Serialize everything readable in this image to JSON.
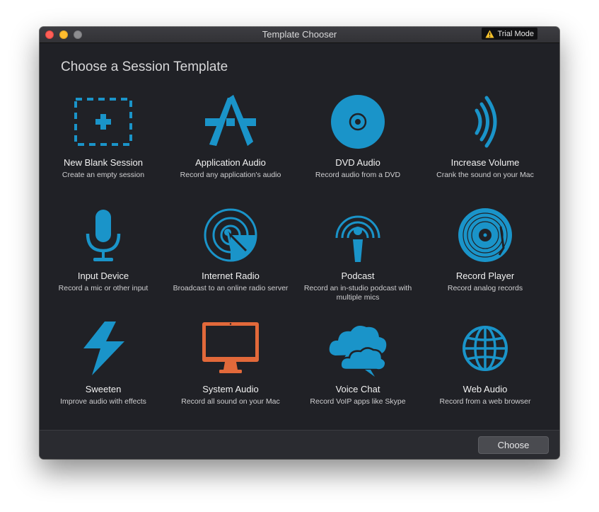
{
  "window": {
    "title": "Template Chooser",
    "trial_badge": "Trial Mode"
  },
  "heading": "Choose a Session Template",
  "colors": {
    "accent": "#1a94c9",
    "system_audio": "#e2693a",
    "warning": "#f5c12b"
  },
  "templates": [
    {
      "name": "New Blank Session",
      "desc": "Create an empty session",
      "icon": "plus-box-icon"
    },
    {
      "name": "Application Audio",
      "desc": "Record any application's audio",
      "icon": "app-store-icon"
    },
    {
      "name": "DVD Audio",
      "desc": "Record audio from a DVD",
      "icon": "disc-icon"
    },
    {
      "name": "Increase Volume",
      "desc": "Crank the sound on your Mac",
      "icon": "volume-waves-icon"
    },
    {
      "name": "Input Device",
      "desc": "Record a mic or other input",
      "icon": "microphone-icon"
    },
    {
      "name": "Internet Radio",
      "desc": "Broadcast to an online radio server",
      "icon": "radio-dish-icon"
    },
    {
      "name": "Podcast",
      "desc": "Record an in-studio podcast with multiple mics",
      "icon": "podcast-icon"
    },
    {
      "name": "Record Player",
      "desc": "Record analog records",
      "icon": "vinyl-record-icon"
    },
    {
      "name": "Sweeten",
      "desc": "Improve audio with effects",
      "icon": "lightning-icon"
    },
    {
      "name": "System Audio",
      "desc": "Record all sound on your Mac",
      "icon": "imac-icon"
    },
    {
      "name": "Voice Chat",
      "desc": "Record VoIP apps like Skype",
      "icon": "chat-clouds-icon"
    },
    {
      "name": "Web Audio",
      "desc": "Record from a web browser",
      "icon": "globe-icon"
    }
  ],
  "footer": {
    "choose_label": "Choose"
  }
}
